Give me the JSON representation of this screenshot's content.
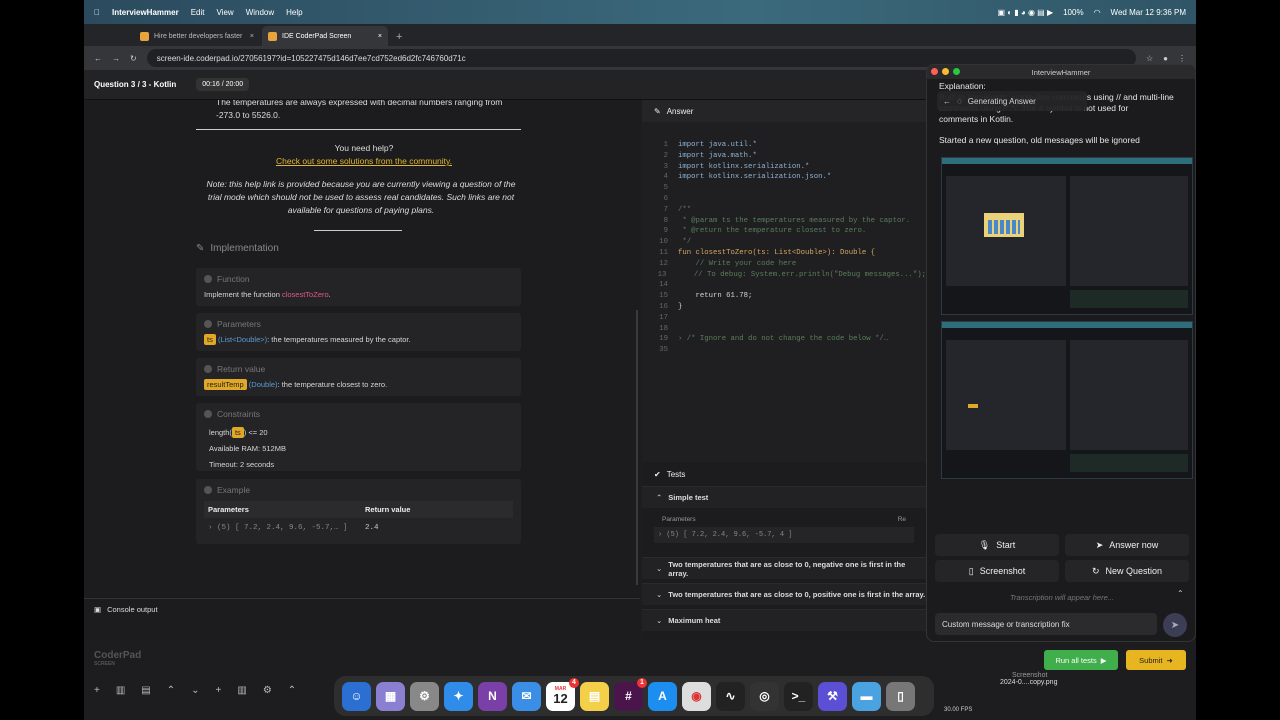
{
  "menubar": {
    "app": "InterviewHammer",
    "items": [
      "Edit",
      "View",
      "Window",
      "Help"
    ],
    "battery": "100%",
    "clock": "Wed Mar 12  9:36 PM"
  },
  "tabs": [
    {
      "label": "Hire better developers faster"
    },
    {
      "label": "IDE CoderPad Screen"
    }
  ],
  "url": "screen-ide.coderpad.io/27056197?id=105227475d146d7ee7cd752ed6d2fc746760d71c",
  "question": {
    "label": "Question 3 / 3 - Kotlin",
    "timer": "00:16 / 20:00"
  },
  "problem": {
    "partial": "The temperatures are always expressed with decimal numbers ranging from -273.0 to 5526.0.",
    "help_title": "You need help?",
    "help_link": "Check out some solutions from the community.",
    "note": "Note: this help link is provided because you are currently viewing a question of the trial mode which should not be used to assess real candidates. Such links are not available for questions of paying plans.",
    "implementation": "Implementation",
    "function_h": "Function",
    "function_text": "Implement the function ",
    "function_name": "closestToZero",
    "params_h": "Parameters",
    "param_tag": "ts",
    "param_type": "(List<Double>)",
    "param_desc": ": the temperatures measured by the captor.",
    "return_h": "Return value",
    "return_tag": "resultTemp",
    "return_type": "(Double)",
    "return_desc": ": the temperature closest to zero.",
    "constraints_h": "Constraints",
    "c1a": "length(",
    "c1tag": "ts",
    "c1b": ") <= 20",
    "c2": "Available RAM: 512MB",
    "c3": "Timeout: 2 seconds",
    "example_h": "Example",
    "ex_params": "Parameters",
    "ex_return": "Return value",
    "ex_value": "› (5) [ 7.2, 2.4, 9.6, -5.7,… ]",
    "ex_ret_value": "2.4"
  },
  "console": "Console output",
  "brand": "CoderPad",
  "brand_sub": "SCREEN",
  "answer_tab": "Answer",
  "code": [
    {
      "n": "1",
      "t": "import java.util.*"
    },
    {
      "n": "2",
      "t": "import java.math.*"
    },
    {
      "n": "3",
      "t": "import kotlinx.serialization.*"
    },
    {
      "n": "4",
      "t": "import kotlinx.serialization.json.*"
    },
    {
      "n": "5",
      "t": ""
    },
    {
      "n": "6",
      "t": ""
    },
    {
      "n": "7",
      "t": "/**"
    },
    {
      "n": "8",
      "t": " * @param ts the temperatures measured by the captor."
    },
    {
      "n": "9",
      "t": " * @return the temperature closest to zero."
    },
    {
      "n": "10",
      "t": " */"
    },
    {
      "n": "11",
      "t": "fun closestToZero(ts: List<Double>): Double {"
    },
    {
      "n": "12",
      "t": "    // Write your code here"
    },
    {
      "n": "13",
      "t": "    // To debug: System.err.println(\"Debug messages...\");"
    },
    {
      "n": "14",
      "t": ""
    },
    {
      "n": "15",
      "t": "    return 61.78;"
    },
    {
      "n": "16",
      "t": "}"
    },
    {
      "n": "17",
      "t": ""
    },
    {
      "n": "18",
      "t": ""
    },
    {
      "n": "19",
      "t": "› /* Ignore and do not change the code below */…"
    },
    {
      "n": "35",
      "t": ""
    }
  ],
  "tests": {
    "title": "Tests",
    "simple": "Simple test",
    "params": "Parameters",
    "re": "Re",
    "simple_value": "› (5) [ 7.2, 2.4, 9.6, -5.7, 4 ]",
    "items": [
      "Two temperatures that are as close to 0, negative one is first in the array.",
      "Two temperatures that are as close to 0, positive one is first in the array.",
      "Maximum heat"
    ]
  },
  "buttons": {
    "run": "Run all tests",
    "submit": "Submit"
  },
  "ih": {
    "title": "InterviewHammer",
    "explanation": "Explanation:",
    "line1": "Built-in comments: single-line comments using // and multi-line",
    "line2": "comments using /* */. The # symbol is not used for",
    "line3": "comments in Kotlin.",
    "generating": "Generating Answer",
    "started": "Started a new question, old messages will be ignored",
    "start": "Start",
    "answer_now": "Answer now",
    "screenshot": "Screenshot",
    "new_question": "New Question",
    "transcription": "Transcription will appear here...",
    "input_placeholder": "Custom message or transcription fix"
  },
  "desktop": {
    "file1": "Screenshot",
    "file2": "2024-0....copy.png",
    "fps": "30.00 FPS"
  },
  "dock_badge1": "4",
  "dock_badge2": "1",
  "cal_month": "MAR",
  "cal_day": "12"
}
